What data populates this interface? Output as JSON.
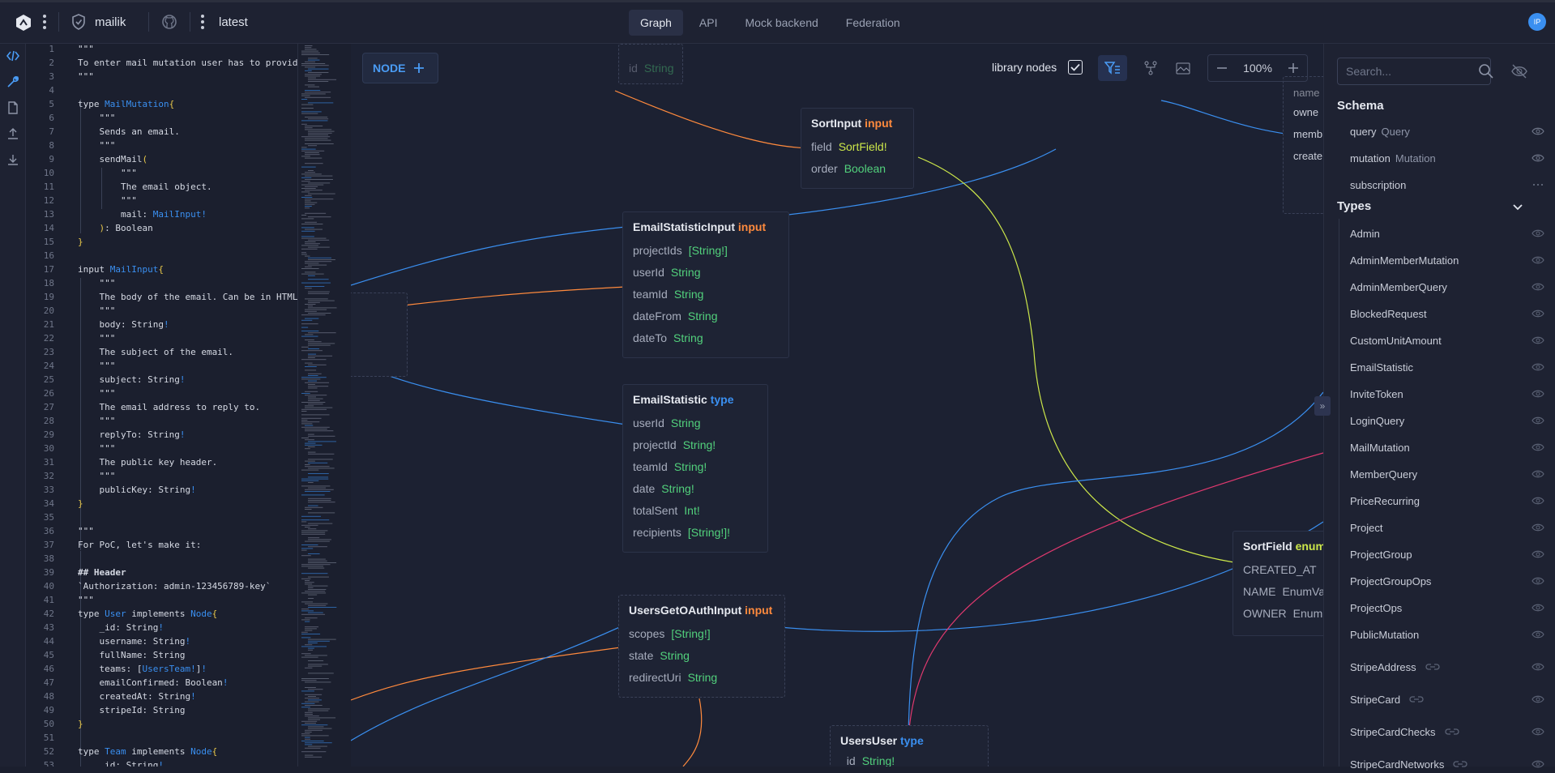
{
  "topbar": {
    "project": "mailik",
    "version": "latest",
    "tabs": [
      {
        "label": "Graph",
        "active": true
      },
      {
        "label": "API",
        "active": false
      },
      {
        "label": "Mock backend",
        "active": false
      },
      {
        "label": "Federation",
        "active": false
      }
    ],
    "avatar_initials": "IP"
  },
  "editor": {
    "lines": [
      {
        "n": "1",
        "t": "\"\"\""
      },
      {
        "n": "2",
        "t": "To enter mail mutation user has to provid"
      },
      {
        "n": "3",
        "t": "\"\"\""
      },
      {
        "n": "4",
        "t": ""
      },
      {
        "n": "5",
        "t": "type MailMutation{"
      },
      {
        "n": "6",
        "t": "    \"\"\""
      },
      {
        "n": "7",
        "t": "    Sends an email."
      },
      {
        "n": "8",
        "t": "    \"\"\""
      },
      {
        "n": "9",
        "t": "    sendMail("
      },
      {
        "n": "10",
        "t": "        \"\"\""
      },
      {
        "n": "11",
        "t": "        The email object."
      },
      {
        "n": "12",
        "t": "        \"\"\""
      },
      {
        "n": "13",
        "t": "        mail: MailInput!"
      },
      {
        "n": "14",
        "t": "    ): Boolean"
      },
      {
        "n": "15",
        "t": "}"
      },
      {
        "n": "16",
        "t": ""
      },
      {
        "n": "17",
        "t": "input MailInput{"
      },
      {
        "n": "18",
        "t": "    \"\"\""
      },
      {
        "n": "19",
        "t": "    The body of the email. Can be in HTML"
      },
      {
        "n": "20",
        "t": "    \"\"\""
      },
      {
        "n": "21",
        "t": "    body: String!"
      },
      {
        "n": "22",
        "t": "    \"\"\""
      },
      {
        "n": "23",
        "t": "    The subject of the email."
      },
      {
        "n": "24",
        "t": "    \"\"\""
      },
      {
        "n": "25",
        "t": "    subject: String!"
      },
      {
        "n": "26",
        "t": "    \"\"\""
      },
      {
        "n": "27",
        "t": "    The email address to reply to."
      },
      {
        "n": "28",
        "t": "    \"\"\""
      },
      {
        "n": "29",
        "t": "    replyTo: String!"
      },
      {
        "n": "30",
        "t": "    \"\"\""
      },
      {
        "n": "31",
        "t": "    The public key header."
      },
      {
        "n": "32",
        "t": "    \"\"\""
      },
      {
        "n": "33",
        "t": "    publicKey: String!"
      },
      {
        "n": "34",
        "t": "}"
      },
      {
        "n": "35",
        "t": ""
      },
      {
        "n": "36",
        "t": "\"\"\""
      },
      {
        "n": "37",
        "t": "For PoC, let's make it:"
      },
      {
        "n": "38",
        "t": ""
      },
      {
        "n": "39",
        "t": "## Header"
      },
      {
        "n": "40",
        "t": "`Authorization: admin-123456789-key`"
      },
      {
        "n": "41",
        "t": "\"\"\""
      },
      {
        "n": "42",
        "t": "type User implements Node{"
      },
      {
        "n": "43",
        "t": "    _id: String!"
      },
      {
        "n": "44",
        "t": "    username: String!"
      },
      {
        "n": "45",
        "t": "    fullName: String"
      },
      {
        "n": "46",
        "t": "    teams: [UsersTeam!]!"
      },
      {
        "n": "47",
        "t": "    emailConfirmed: Boolean!"
      },
      {
        "n": "48",
        "t": "    createdAt: String!"
      },
      {
        "n": "49",
        "t": "    stripeId: String"
      },
      {
        "n": "50",
        "t": "}"
      },
      {
        "n": "51",
        "t": ""
      },
      {
        "n": "52",
        "t": "type Team implements Node{"
      },
      {
        "n": "53",
        "t": "    _id: String!"
      }
    ]
  },
  "graph": {
    "node_button": "NODE",
    "library_nodes_label": "library nodes",
    "library_nodes_checked": true,
    "zoom": "100%",
    "nodes": {
      "sort_input": {
        "name": "SortInput",
        "kind": "input",
        "fields": [
          {
            "name": "field",
            "type": "SortField!"
          },
          {
            "name": "order",
            "type": "Boolean"
          }
        ]
      },
      "email_statistic_input": {
        "name": "EmailStatisticInput",
        "kind": "input",
        "fields": [
          {
            "name": "projectIds",
            "type": "[String!]"
          },
          {
            "name": "userId",
            "type": "String"
          },
          {
            "name": "teamId",
            "type": "String"
          },
          {
            "name": "dateFrom",
            "type": "String"
          },
          {
            "name": "dateTo",
            "type": "String"
          }
        ]
      },
      "email_statistic": {
        "name": "EmailStatistic",
        "kind": "type",
        "fields": [
          {
            "name": "userId",
            "type": "String"
          },
          {
            "name": "projectId",
            "type": "String!"
          },
          {
            "name": "teamId",
            "type": "String!"
          },
          {
            "name": "date",
            "type": "String!"
          },
          {
            "name": "totalSent",
            "type": "Int!"
          },
          {
            "name": "recipients",
            "type": "[String!]!"
          }
        ]
      },
      "users_get_oauth_input": {
        "name": "UsersGetOAuthInput",
        "kind": "input",
        "fields": [
          {
            "name": "scopes",
            "type": "[String!]"
          },
          {
            "name": "state",
            "type": "String"
          },
          {
            "name": "redirectUri",
            "type": "String"
          }
        ]
      },
      "sort_field": {
        "name": "SortField",
        "kind": "enum",
        "fields": [
          {
            "name": "CREATED_AT",
            "type": "E"
          },
          {
            "name": "NAME",
            "type": "EnumVa"
          },
          {
            "name": "OWNER",
            "type": "Enum"
          }
        ]
      },
      "users_user": {
        "name": "UsersUser",
        "kind": "type",
        "fields": [
          {
            "name": "_id",
            "type": "String!"
          }
        ]
      },
      "top_partial": {
        "fields": [
          {
            "name": "id",
            "type": "String"
          }
        ]
      },
      "right_partial": {
        "fields": [
          {
            "name": "name"
          },
          {
            "name": "owne"
          },
          {
            "name": "memb"
          },
          {
            "name": "create"
          }
        ]
      }
    }
  },
  "sidebar": {
    "search_placeholder": "Search...",
    "schema_heading": "Schema",
    "schema_rows": [
      {
        "label": "query",
        "sub": "Query"
      },
      {
        "label": "mutation",
        "sub": "Mutation"
      },
      {
        "label": "subscription",
        "sub": ""
      }
    ],
    "types_heading": "Types",
    "types": [
      "Admin",
      "AdminMemberMutation",
      "AdminMemberQuery",
      "BlockedRequest",
      "CustomUnitAmount",
      "EmailStatistic",
      "InviteToken",
      "LoginQuery",
      "MailMutation",
      "MemberQuery",
      "PriceRecurring",
      "Project",
      "ProjectGroup",
      "ProjectGroupOps",
      "ProjectOps",
      "PublicMutation",
      "StripeAddress",
      "StripeCard",
      "StripeCardChecks",
      "StripeCardNetworks"
    ],
    "linked_types": [
      "StripeAddress",
      "StripeCard",
      "StripeCardChecks",
      "StripeCardNetworks"
    ]
  },
  "colors": {
    "accent": "#3a8ff0",
    "input_kind": "#ff8a3d",
    "enum_kind": "#cde84a",
    "scalar_type": "#52d17c"
  }
}
